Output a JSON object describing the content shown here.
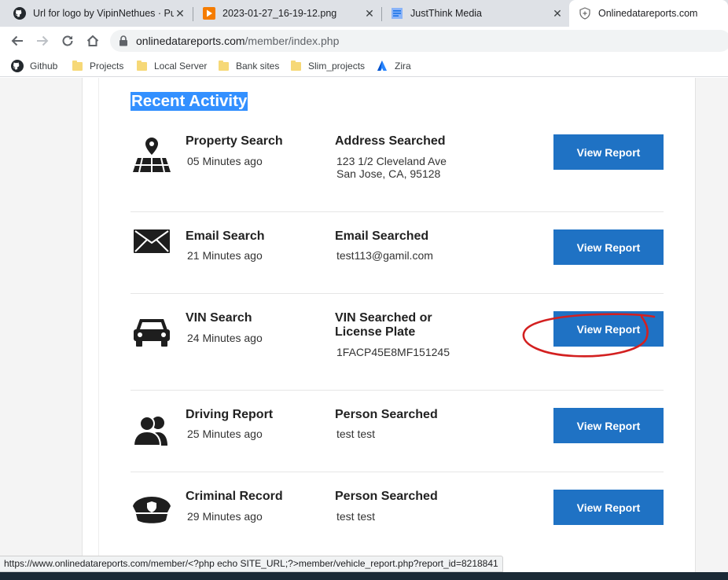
{
  "browser": {
    "tabs": [
      {
        "title": "Url for logo by VipinNethues · Pu",
        "icon": "github-icon"
      },
      {
        "title": "2023-01-27_16-19-12.png",
        "icon": "image-play-icon"
      },
      {
        "title": "JustThink Media",
        "icon": "justthink-icon"
      },
      {
        "title": "Onlinedatareports.com",
        "icon": "shield-icon"
      }
    ],
    "close_glyph": "✕",
    "url_domain": "onlinedatareports.com",
    "url_path": "/member/index.php",
    "bookmarks": [
      {
        "label": "Github",
        "icon": "github-icon"
      },
      {
        "label": "Projects",
        "icon": "folder-icon"
      },
      {
        "label": "Local Server",
        "icon": "folder-icon"
      },
      {
        "label": "Bank sites",
        "icon": "folder-icon"
      },
      {
        "label": "Slim_projects",
        "icon": "folder-icon"
      },
      {
        "label": "Zira",
        "icon": "zira-icon"
      }
    ]
  },
  "page": {
    "heading": "Recent Activity",
    "rows": [
      {
        "title": "Property Search",
        "time": "05 Minutes ago",
        "label": "Address Searched",
        "value_lines": [
          "123 1/2 Cleveland Ave",
          "San Jose, CA, 95128"
        ],
        "button": "View Report",
        "icon": "map-pin-icon"
      },
      {
        "title": "Email Search",
        "time": "21 Minutes ago",
        "label": "Email Searched",
        "value_lines": [
          "test113@gamil.com"
        ],
        "button": "View Report",
        "icon": "envelope-icon"
      },
      {
        "title": "VIN Search",
        "time": "24 Minutes ago",
        "label_lines": [
          "VIN Searched or",
          "License Plate"
        ],
        "value_lines": [
          "1FACP45E8MF151245"
        ],
        "button": "View Report",
        "icon": "car-icon"
      },
      {
        "title": "Driving Report",
        "time": "25 Minutes ago",
        "label": "Person Searched",
        "value_lines": [
          "test test"
        ],
        "button": "View Report",
        "icon": "people-icon"
      },
      {
        "title": "Criminal Record",
        "time": "29 Minutes ago",
        "label": "Person Searched",
        "value_lines": [
          "test test"
        ],
        "button": "View Report",
        "icon": "police-cap-icon"
      }
    ]
  },
  "status_url": "https://www.onlinedatareports.com/member/<?php echo SITE_URL;?>member/vehicle_report.php?report_id=8218841",
  "colors": {
    "accent": "#1f72c4",
    "highlight": "#3390ff",
    "annotation": "#d32020"
  }
}
